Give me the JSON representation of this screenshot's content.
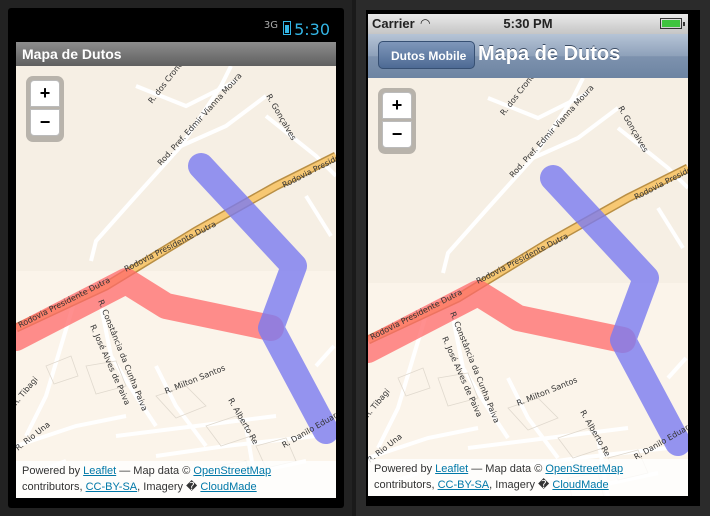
{
  "android": {
    "status": {
      "network": "3G",
      "time": "5:30"
    },
    "title": "Mapa de Dutos"
  },
  "iphone": {
    "status": {
      "carrier": "Carrier",
      "time": "5:30 PM"
    },
    "back_label": "Dutos Mobile",
    "title": "Mapa de Dutos"
  },
  "map": {
    "zoom_in": "+",
    "zoom_out": "−",
    "attribution": {
      "powered_by": "Powered by",
      "leaflet": "Leaflet",
      "map_data": "— Map data ©",
      "osm": "OpenStreetMap",
      "contributors": "contributors,",
      "license": "CC-BY-SA",
      "imagery": ", Imagery �",
      "cloudmade": "CloudMade"
    },
    "labels": {
      "dutra_a": "Rodovia Presidente Dutra",
      "dutra_b": "Rodovia Presidente Dutra",
      "dutra_c": "Rodovia Presidente",
      "cronopios": "R. dos Cronópios",
      "edmir": "Rod. Pref. Edmir Vianna Moura",
      "goncalves": "R. Gonçalves",
      "constancia": "R. Constância da Cunha Paiva",
      "alves": "R. José Alves de Paiva",
      "milton": "R. Milton Santos",
      "alberto": "R. Alberto Re",
      "tibagi": "R. Tibagi",
      "riouna": "R. Rio Una",
      "danilo": "R. Danilo Eduardo"
    },
    "colors": {
      "pipeline_blue": "#7b7bf0",
      "pipeline_red": "#ff6a6a",
      "highway": "#f7c873"
    }
  }
}
